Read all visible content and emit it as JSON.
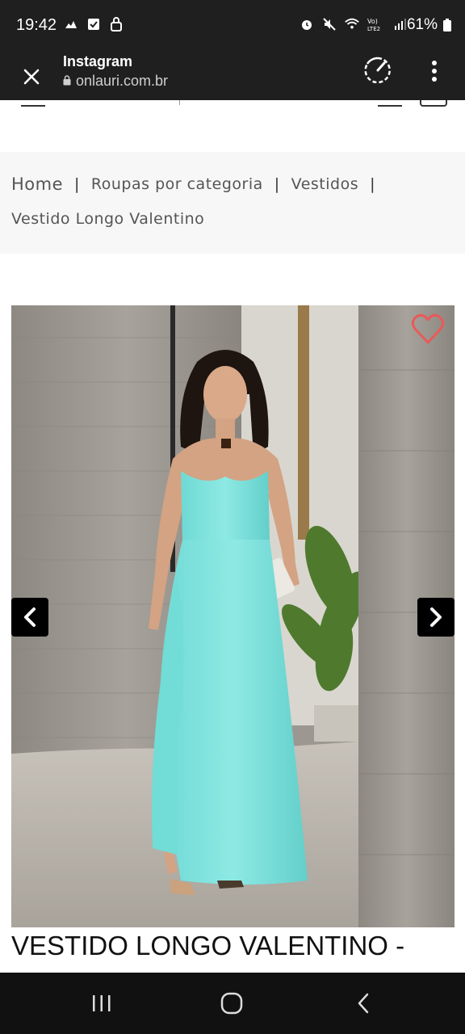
{
  "status_bar": {
    "time": "19:42",
    "battery": "61%",
    "left_icons": [
      "cloud-icon",
      "check-square-icon",
      "lock-icon"
    ],
    "right_icons": [
      "alarm-icon",
      "mute-icon",
      "wifi-icon",
      "volte-icon",
      "signal-icon"
    ]
  },
  "browser": {
    "app_title": "Instagram",
    "url": "onlauri.com.br"
  },
  "breadcrumb": {
    "items": [
      "Home",
      "Roupas por categoria",
      "Vestidos"
    ],
    "separator": "|",
    "current": "Vestido Longo Valentino"
  },
  "product": {
    "title": "VESTIDO LONGO VALENTINO -",
    "dress_color": "#7ee3df",
    "favorite_color": "#e85a5a"
  }
}
